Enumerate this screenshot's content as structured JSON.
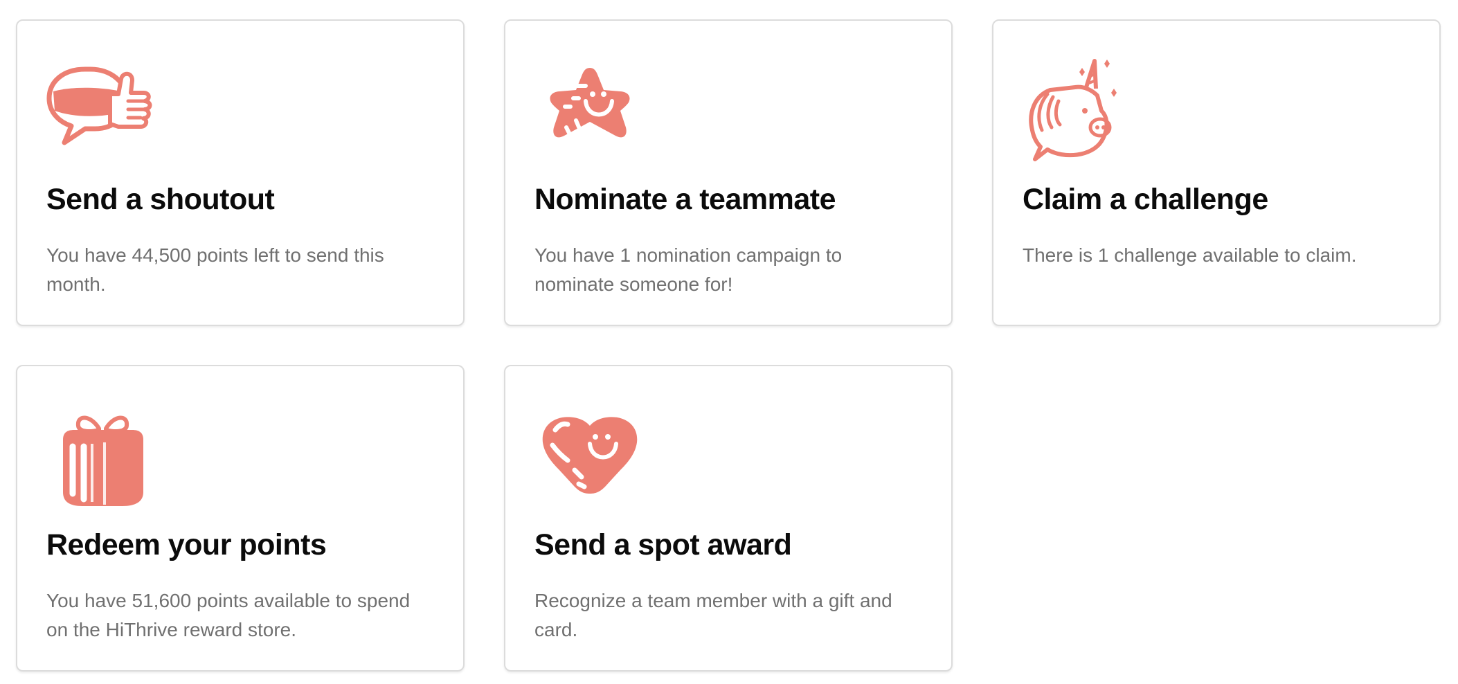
{
  "accent_color": "#ec7f72",
  "cards": [
    {
      "icon": "thumbs-up-speech-bubble-icon",
      "title": "Send a shoutout",
      "description": "You have 44,500 points left to send this month."
    },
    {
      "icon": "smiling-star-icon",
      "title": "Nominate a teammate",
      "description": "You have 1 nomination campaign to nominate someone for!"
    },
    {
      "icon": "unicorn-speech-bubble-icon",
      "title": "Claim a challenge",
      "description": "There is 1 challenge available to claim."
    },
    {
      "icon": "gift-box-icon",
      "title": "Redeem your points",
      "description": "You have 51,600 points available to spend on the HiThrive reward store."
    },
    {
      "icon": "smiling-heart-icon",
      "title": "Send a spot award",
      "description": "Recognize a team member with a gift and card."
    }
  ]
}
